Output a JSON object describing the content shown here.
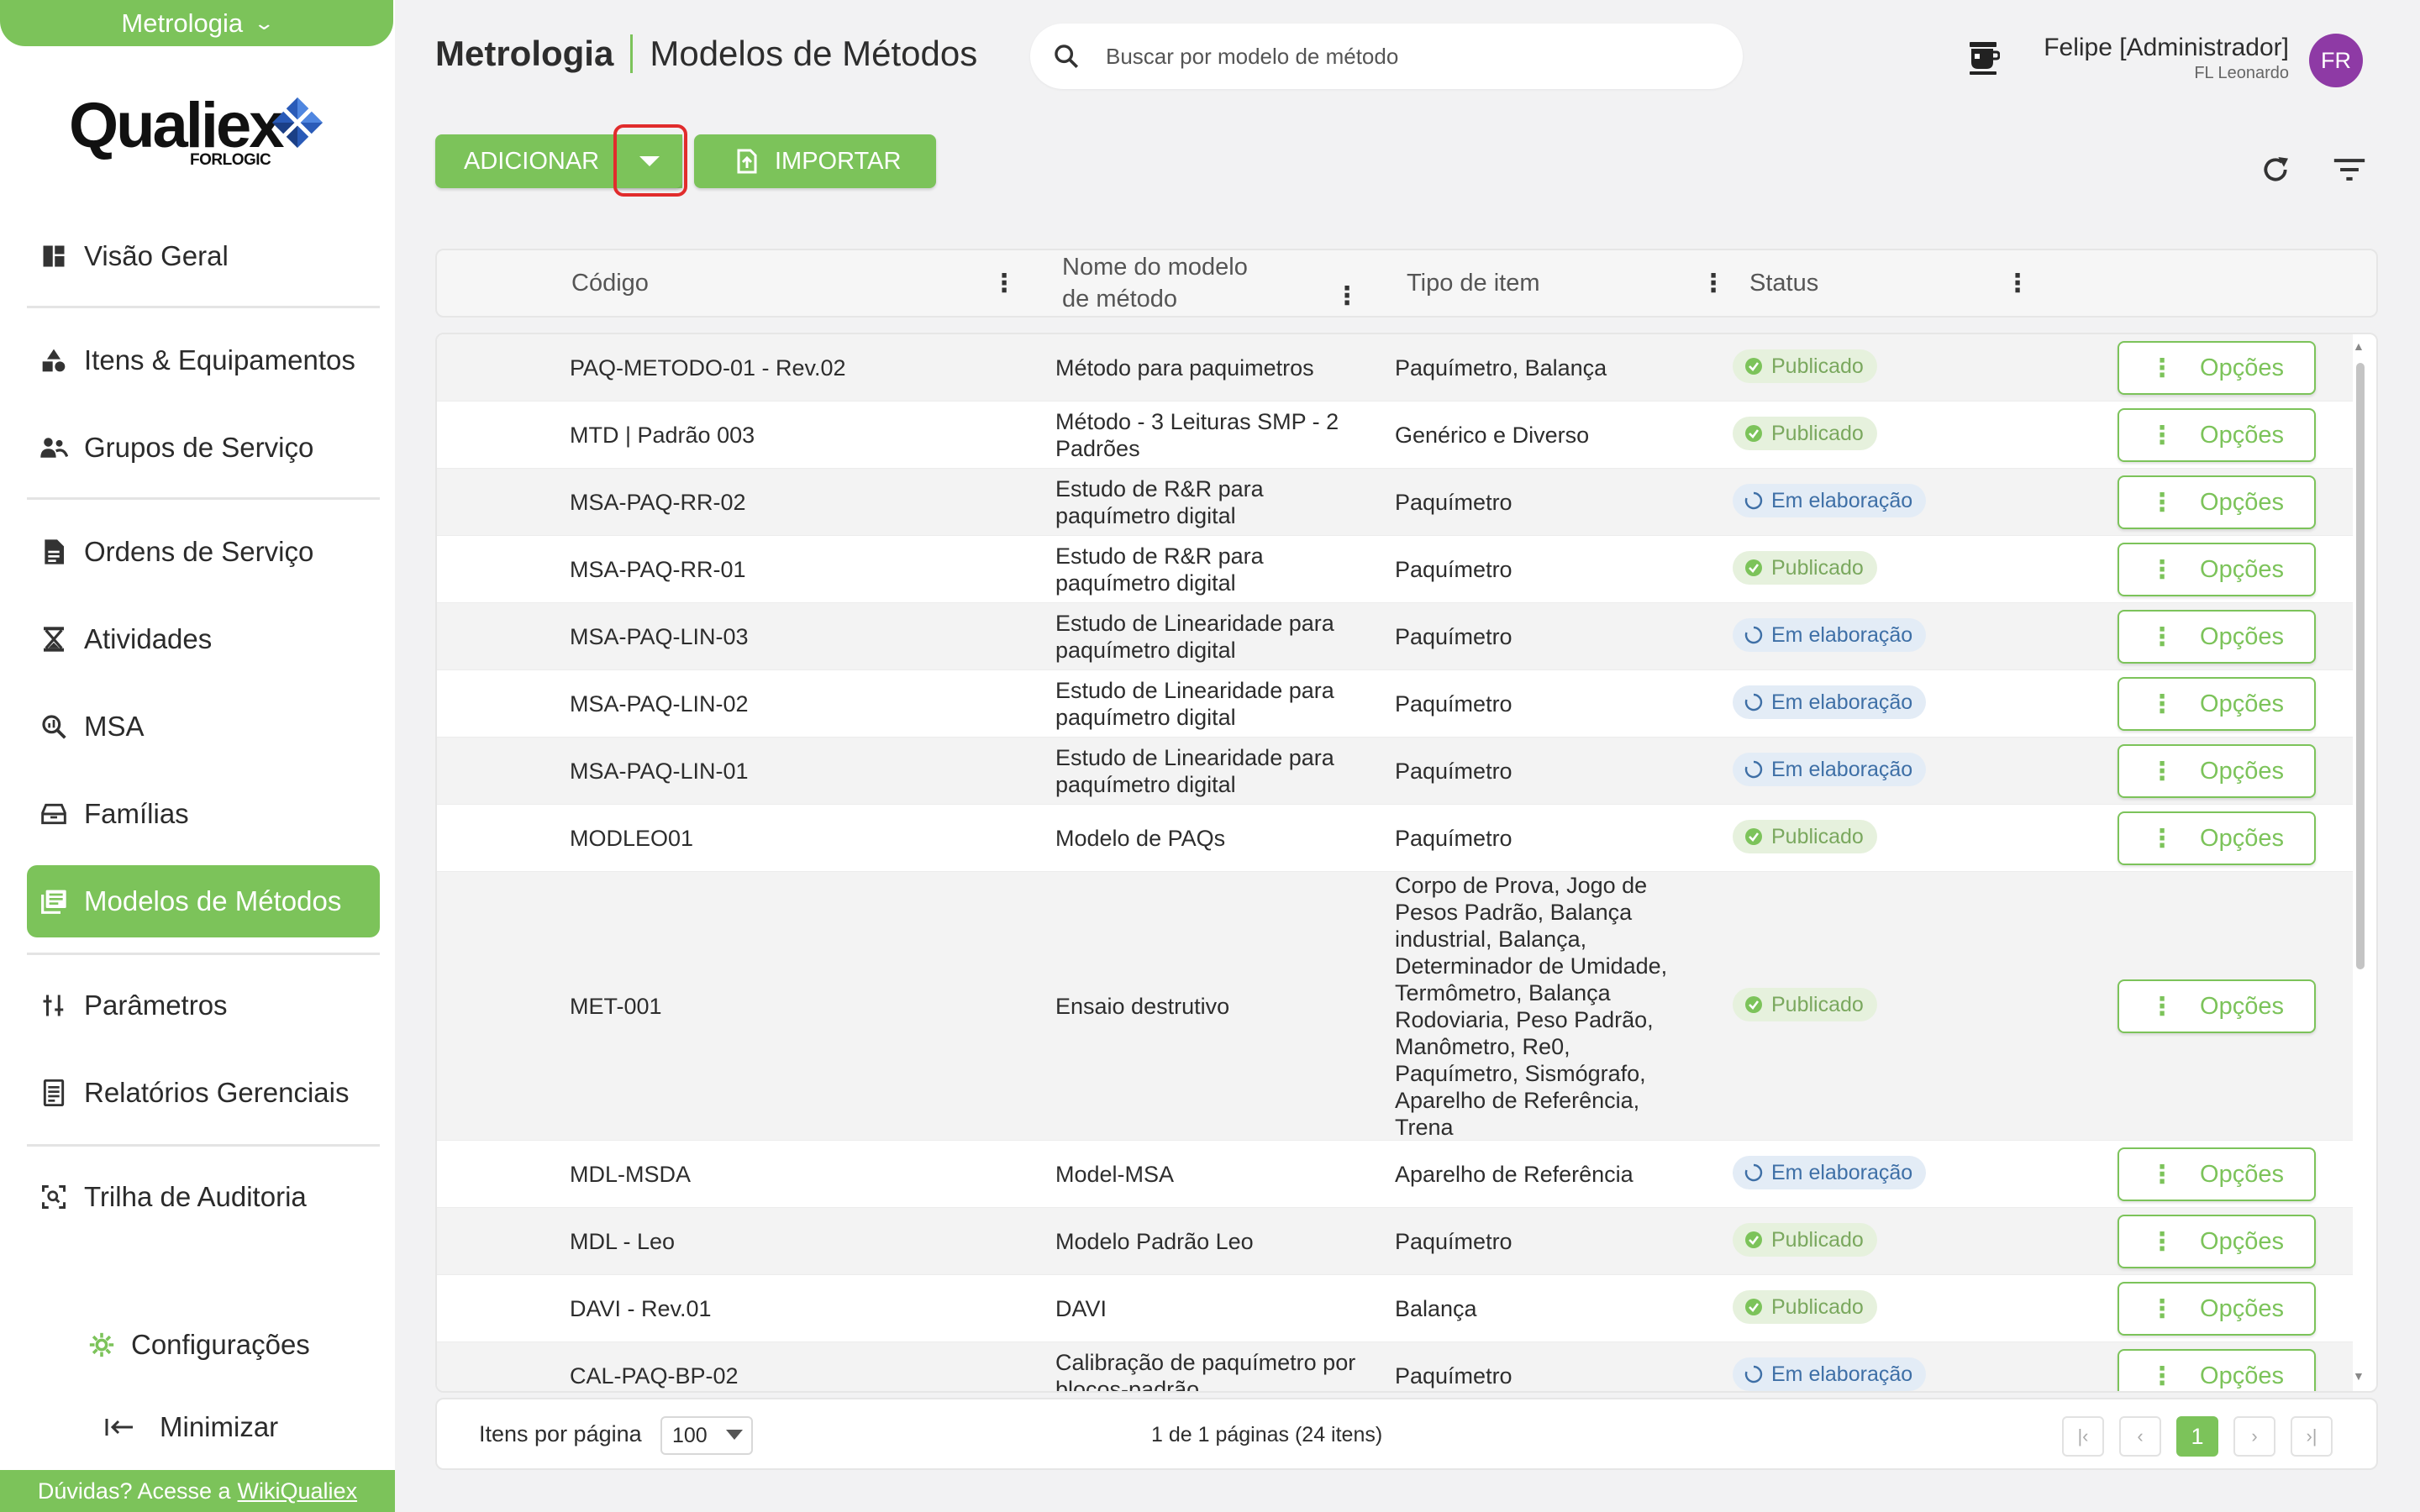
{
  "module_selector": {
    "label": "Metrologia"
  },
  "logo": {
    "word": "Qualiex",
    "sub": "FORLOGIC"
  },
  "sidebar": {
    "items": [
      {
        "label": "Visão Geral",
        "icon": "dashboard-icon"
      },
      {
        "label": "Itens & Equipamentos",
        "icon": "shapes-icon"
      },
      {
        "label": "Grupos de Serviço",
        "icon": "group-icon"
      },
      {
        "label": "Ordens de Serviço",
        "icon": "document-icon"
      },
      {
        "label": "Atividades",
        "icon": "hourglass-icon"
      },
      {
        "label": "MSA",
        "icon": "zoom-icon"
      },
      {
        "label": "Famílias",
        "icon": "drawer-icon"
      },
      {
        "label": "Modelos de Métodos",
        "icon": "library-icon",
        "active": true
      },
      {
        "label": "Parâmetros",
        "icon": "sliders-icon"
      },
      {
        "label": "Relatórios Gerenciais",
        "icon": "report-icon"
      },
      {
        "label": "Trilha de Auditoria",
        "icon": "audit-icon"
      }
    ],
    "settings_label": "Configurações",
    "minimize_label": "Minimizar",
    "help_text": "Dúvidas? Acesse a",
    "help_link": "WikiQualiex"
  },
  "header": {
    "module": "Metrologia",
    "page": "Modelos de Métodos",
    "search_placeholder": "Buscar por modelo de método",
    "user_name": "Felipe [Administrador]",
    "user_org": "FL Leonardo",
    "avatar_initials": "FR"
  },
  "toolbar": {
    "add_label": "ADICIONAR",
    "import_label": "IMPORTAR"
  },
  "table": {
    "columns": [
      "Código",
      "Nome do modelo de método",
      "Tipo de item",
      "Status"
    ],
    "options_label": "Opções",
    "rows": [
      {
        "code": "PAQ-METODO-01 - Rev.02",
        "name": "Método para paquimetros",
        "type": "Paquímetro, Balança",
        "status": "Publicado"
      },
      {
        "code": "MTD | Padrão 003",
        "name": "Método - 3 Leituras SMP - 2 Padrões",
        "type": "Genérico e Diverso",
        "status": "Publicado"
      },
      {
        "code": "MSA-PAQ-RR-02",
        "name": "Estudo de R&R para paquímetro digital",
        "type": "Paquímetro",
        "status": "Em elaboração"
      },
      {
        "code": "MSA-PAQ-RR-01",
        "name": "Estudo de R&R para paquímetro digital",
        "type": "Paquímetro",
        "status": "Publicado"
      },
      {
        "code": "MSA-PAQ-LIN-03",
        "name": "Estudo de Linearidade para paquímetro digital",
        "type": "Paquímetro",
        "status": "Em elaboração"
      },
      {
        "code": "MSA-PAQ-LIN-02",
        "name": "Estudo de Linearidade para paquímetro digital",
        "type": "Paquímetro",
        "status": "Em elaboração"
      },
      {
        "code": "MSA-PAQ-LIN-01",
        "name": "Estudo de Linearidade para paquímetro digital",
        "type": "Paquímetro",
        "status": "Em elaboração"
      },
      {
        "code": "MODLEO01",
        "name": "Modelo de PAQs",
        "type": "Paquímetro",
        "status": "Publicado"
      },
      {
        "code": "MET-001",
        "name": "Ensaio destrutivo",
        "type": "Corpo de Prova, Jogo de Pesos Padrão, Balança industrial, Balança, Determinador de Umidade, Termômetro, Balança Rodoviaria, Peso Padrão, Manômetro, Re0, Paquímetro, Sismógrafo, Aparelho de Referência, Trena",
        "status": "Publicado"
      },
      {
        "code": "MDL-MSDA",
        "name": "Model-MSA",
        "type": "Aparelho de Referência",
        "status": "Em elaboração"
      },
      {
        "code": "MDL - Leo",
        "name": "Modelo Padrão Leo",
        "type": "Paquímetro",
        "status": "Publicado"
      },
      {
        "code": "DAVI - Rev.01",
        "name": "DAVI",
        "type": "Balança",
        "status": "Publicado"
      },
      {
        "code": "CAL-PAQ-BP-02",
        "name": "Calibração de paquímetro por blocos-padrão",
        "type": "Paquímetro",
        "status": "Em elaboração"
      }
    ]
  },
  "pagination": {
    "per_page_label": "Itens por página",
    "per_page_value": "100",
    "info": "1 de 1 páginas (24 itens)",
    "current_page": "1"
  },
  "colors": {
    "brand_green": "#7cc35a",
    "published": "#7aa85e",
    "in_progress": "#3e6fa6",
    "highlight": "#e12c2c"
  }
}
